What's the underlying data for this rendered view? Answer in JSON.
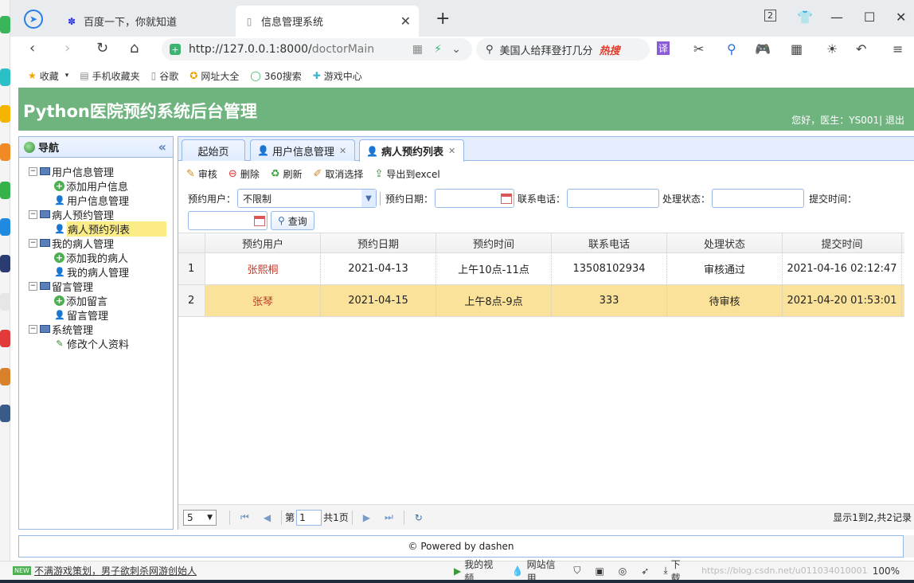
{
  "browser": {
    "tabs": [
      {
        "label": "百度一下，你就知道",
        "active": false
      },
      {
        "label": "信息管理系统",
        "active": true
      }
    ],
    "address": {
      "host": "http://127.0.0.1:8000/",
      "path": "doctorMain"
    },
    "search": {
      "text": "美国人给拜登打几分",
      "hot_label": "热搜"
    },
    "tab_count": "2",
    "bookmarks": [
      "收藏",
      "手机收藏夹",
      "谷歌",
      "网址大全",
      "360搜索",
      "游戏中心"
    ]
  },
  "app": {
    "title": "Python医院预约系统后台管理",
    "user_greeting": "您好，医生：YS001|",
    "logout": "退出"
  },
  "nav": {
    "title": "导航",
    "groups": [
      {
        "label": "用户信息管理",
        "items": [
          "添加用户信息",
          "用户信息管理"
        ]
      },
      {
        "label": "病人预约管理",
        "items": [
          "病人预约列表"
        ]
      },
      {
        "label": "我的病人管理",
        "items": [
          "添加我的病人",
          "我的病人管理"
        ]
      },
      {
        "label": "留言管理",
        "items": [
          "添加留言",
          "留言管理"
        ]
      },
      {
        "label": "系统管理",
        "items": [
          "修改个人资料"
        ]
      }
    ]
  },
  "content_tabs": [
    {
      "label": "起始页"
    },
    {
      "label": "用户信息管理"
    },
    {
      "label": "病人预约列表"
    }
  ],
  "toolbar": {
    "audit": "审核",
    "delete": "删除",
    "refresh": "刷新",
    "cancel_select": "取消选择",
    "export": "导出到excel"
  },
  "filters": {
    "user_label": "预约用户：",
    "user_value": "不限制",
    "date_label": "预约日期：",
    "phone_label": "联系电话：",
    "status_label": "处理状态：",
    "submit_time_label": "提交时间：",
    "query": "查询"
  },
  "grid": {
    "columns": [
      "预约用户",
      "预约日期",
      "预约时间",
      "联系电话",
      "处理状态",
      "提交时间"
    ],
    "rows": [
      {
        "num": "1",
        "user": "张熙桐",
        "date": "2021-04-13",
        "time": "上午10点-11点",
        "phone": "13508102934",
        "status": "审核通过",
        "submit": "2021-04-16 02:12:47"
      },
      {
        "num": "2",
        "user": "张琴",
        "date": "2021-04-15",
        "time": "上午8点-9点",
        "phone": "333",
        "status": "待审核",
        "submit": "2021-04-20 01:53:01"
      }
    ]
  },
  "pager": {
    "page_size": "5",
    "page_prefix": "第",
    "page": "1",
    "total_pages": "共1页",
    "info": "显示1到2,共2记录"
  },
  "footer": {
    "text": "© Powered by dashen"
  },
  "statusbar": {
    "news_badge": "NEW",
    "news": "不满游戏策划，男子欲刺杀网游创始人",
    "items": [
      "我的视频",
      "网站信用",
      "下载",
      "100%"
    ],
    "watermark": "https://blog.csdn.net/u011034010001"
  }
}
